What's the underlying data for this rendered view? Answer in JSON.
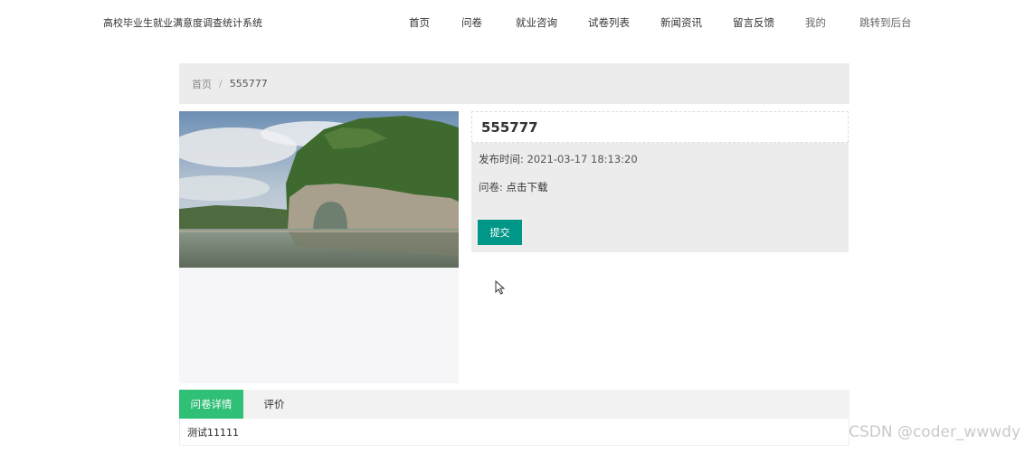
{
  "header": {
    "site_title": "高校毕业生就业满意度调查统计系统",
    "nav": [
      {
        "label": "首页"
      },
      {
        "label": "问卷"
      },
      {
        "label": "就业咨询"
      },
      {
        "label": "试卷列表"
      },
      {
        "label": "新闻资讯"
      },
      {
        "label": "留言反馈"
      },
      {
        "label": "我的"
      },
      {
        "label": "跳转到后台"
      }
    ]
  },
  "breadcrumb": {
    "home": "首页",
    "separator": "/",
    "current": "555777"
  },
  "detail": {
    "title": "555777",
    "publish_label": "发布时间:",
    "publish_time": "2021-03-17 18:13:20",
    "file_label": "问卷:",
    "file_link": "点击下载",
    "submit_label": "提交"
  },
  "tabs": [
    {
      "label": "问卷详情",
      "active": true
    },
    {
      "label": "评价",
      "active": false
    }
  ],
  "tab_content": "测试11111",
  "watermark": "CSDN @coder_wwwdy",
  "colors": {
    "primary_button": "#009688",
    "active_tab": "#2fbf75",
    "panel_bg": "#ececed"
  }
}
